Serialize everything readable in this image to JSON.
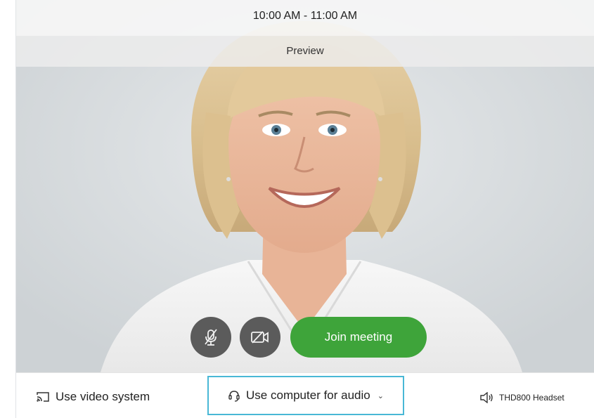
{
  "meeting": {
    "time_range": "10:00 AM - 11:00 AM",
    "preview_label": "Preview"
  },
  "controls": {
    "join_label": "Join meeting",
    "mute_icon": "microphone-muted-icon",
    "video_icon": "video-off-icon"
  },
  "bottom_bar": {
    "video_system_label": "Use video system",
    "audio_option_label": "Use computer for audio",
    "headset_label": "THD800 Headset"
  },
  "colors": {
    "join_green": "#3ea43a",
    "control_gray": "#5b5b5b",
    "focus_blue": "#49b8d6"
  }
}
